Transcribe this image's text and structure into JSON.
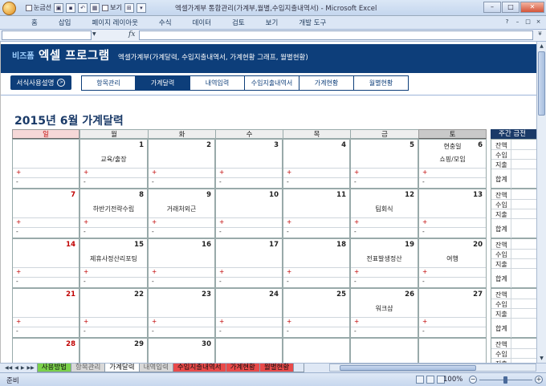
{
  "window": {
    "title": "엑셀가계부 통합관리(가계부,월별,수입지출내역서) - Microsoft Excel",
    "qa_check1": "눈금선",
    "qa_check2": "보기",
    "controls": [
      "–",
      "□",
      "✕"
    ]
  },
  "ribbon": {
    "tabs": [
      "홈",
      "삽입",
      "페이지 레이아웃",
      "수식",
      "데이터",
      "검토",
      "보기",
      "개발 도구"
    ]
  },
  "formula_bar": {
    "name_box": "",
    "fx_label": "fx",
    "value": ""
  },
  "banner": {
    "brand": "비즈폼",
    "program": "엑셀 프로그램",
    "subtitle": "엑셀가계부(가계달력, 수입지출내역서, 가계현황 그래프, 월별현황)"
  },
  "help_button": {
    "label": "서식사용설명",
    "icon": "arrow-right-circle-icon"
  },
  "nav_tabs": [
    {
      "label": "항목관리",
      "active": false
    },
    {
      "label": "가계달력",
      "active": true
    },
    {
      "label": "내역입력",
      "active": false
    },
    {
      "label": "수입지출내역서",
      "active": false
    },
    {
      "label": "가계현황",
      "active": false
    },
    {
      "label": "월별현황",
      "active": false
    }
  ],
  "calendar": {
    "title": "2015년 6월 가계달력",
    "day_headers": [
      "일",
      "월",
      "화",
      "수",
      "목",
      "금",
      "토"
    ],
    "plus": "+",
    "minus": "-",
    "weeks": [
      {
        "days": [
          {
            "num": "",
            "events": []
          },
          {
            "num": "1",
            "events": [
              "교육/출장"
            ]
          },
          {
            "num": "2",
            "events": []
          },
          {
            "num": "3",
            "events": []
          },
          {
            "num": "4",
            "events": []
          },
          {
            "num": "5",
            "events": []
          },
          {
            "num": "6",
            "events": [
              "현충일",
              "쇼핑/모임"
            ]
          }
        ]
      },
      {
        "days": [
          {
            "num": "7",
            "events": []
          },
          {
            "num": "8",
            "events": [
              "하반기전략수립"
            ]
          },
          {
            "num": "9",
            "events": [
              "거래처외근"
            ]
          },
          {
            "num": "10",
            "events": []
          },
          {
            "num": "11",
            "events": []
          },
          {
            "num": "12",
            "events": [
              "팀회식"
            ]
          },
          {
            "num": "13",
            "events": []
          }
        ]
      },
      {
        "days": [
          {
            "num": "14",
            "events": []
          },
          {
            "num": "15",
            "events": [
              "제휴사정산리포팅"
            ]
          },
          {
            "num": "16",
            "events": []
          },
          {
            "num": "17",
            "events": []
          },
          {
            "num": "18",
            "events": []
          },
          {
            "num": "19",
            "events": [
              "전표발생정산"
            ]
          },
          {
            "num": "20",
            "events": [
              "여행"
            ]
          }
        ]
      },
      {
        "days": [
          {
            "num": "21",
            "events": []
          },
          {
            "num": "22",
            "events": []
          },
          {
            "num": "23",
            "events": []
          },
          {
            "num": "24",
            "events": []
          },
          {
            "num": "25",
            "events": []
          },
          {
            "num": "26",
            "events": [
              "워크샵"
            ]
          },
          {
            "num": "27",
            "events": []
          }
        ]
      },
      {
        "days": [
          {
            "num": "28",
            "events": []
          },
          {
            "num": "29",
            "events": []
          },
          {
            "num": "30",
            "events": []
          },
          {
            "num": "",
            "events": []
          },
          {
            "num": "",
            "events": []
          },
          {
            "num": "",
            "events": []
          },
          {
            "num": "",
            "events": []
          }
        ]
      }
    ]
  },
  "weekly_panel": {
    "header": "주간 금전",
    "labels": [
      "잔액",
      "수입",
      "지출",
      "합계"
    ]
  },
  "sheet_tabs": [
    {
      "label": "사용방법",
      "style": "green"
    },
    {
      "label": "항목관리",
      "style": "gray"
    },
    {
      "label": "가계달력",
      "style": "active"
    },
    {
      "label": "내역입력",
      "style": "gray"
    },
    {
      "label": "수입지출내역서",
      "style": "red"
    },
    {
      "label": "가계현황",
      "style": "red"
    },
    {
      "label": "월별현황",
      "style": "red"
    }
  ],
  "status": {
    "ready": "준비",
    "zoom": "100%"
  },
  "colors": {
    "brand_navy": "#0d3e7a",
    "sunday_red": "#c00000",
    "title_navy": "#1a3a68"
  }
}
